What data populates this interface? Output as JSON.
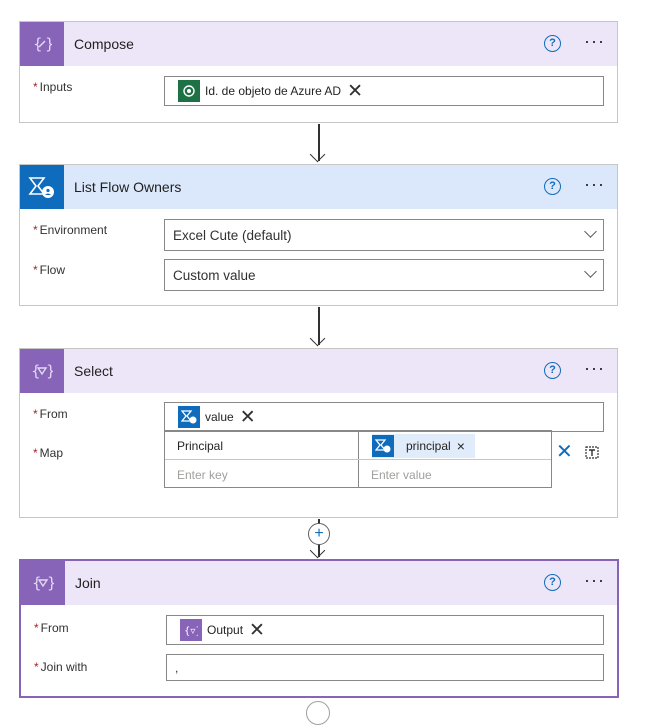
{
  "compose": {
    "title": "Compose",
    "help": "?",
    "more": "···",
    "inputs_label": "Inputs",
    "required_mark": "*",
    "token_label": "Id. de objeto de Azure AD",
    "remove": "✕"
  },
  "list_flow_owners": {
    "title": "List Flow Owners",
    "environment_label": "Environment",
    "environment_value": "Excel Cute (default)",
    "flow_label": "Flow",
    "flow_value": "Custom value"
  },
  "select": {
    "title": "Select",
    "from_label": "From",
    "from_token": "value",
    "map_label": "Map",
    "map_key": "Principal",
    "map_value_token": "principal",
    "key_placeholder": "Enter key",
    "value_placeholder": "Enter value",
    "remove_small": "×"
  },
  "join": {
    "title": "Join",
    "from_label": "From",
    "from_token": "Output",
    "join_with_label": "Join with",
    "join_with_value": ","
  },
  "colors": {
    "purple": "#8764b8",
    "blue": "#0f6cbd",
    "green": "#1e7145"
  }
}
